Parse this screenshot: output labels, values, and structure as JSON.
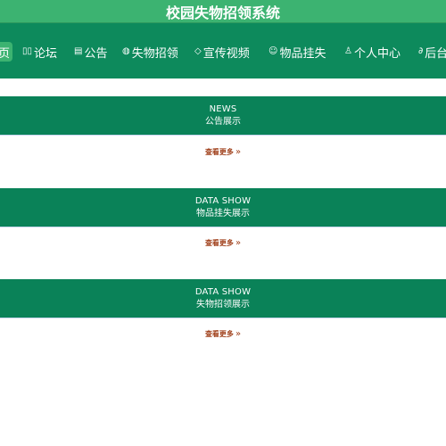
{
  "header": {
    "title": "校园失物招领系统"
  },
  "nav": {
    "items": [
      {
        "label": "页",
        "icon": "home-icon",
        "glyph": ""
      },
      {
        "label": "论坛",
        "icon": "forum-icon",
        "glyph": "▯▯"
      },
      {
        "label": "公告",
        "icon": "notice-icon",
        "glyph": "▤"
      },
      {
        "label": "失物招领",
        "icon": "globe-icon",
        "glyph": "◍"
      },
      {
        "label": "宣传视频",
        "icon": "tag-icon",
        "glyph": "◇"
      },
      {
        "label": "物品挂失",
        "icon": "smile-icon",
        "glyph": "☺"
      },
      {
        "label": "个人中心",
        "icon": "user-icon",
        "glyph": "♙"
      },
      {
        "label": "后台",
        "icon": "link-icon",
        "glyph": "∂"
      }
    ]
  },
  "sections": [
    {
      "en": "NEWS",
      "cn": "公告展示",
      "more": "查看更多"
    },
    {
      "en": "DATA SHOW",
      "cn": "物品挂失展示",
      "more": "查看更多"
    },
    {
      "en": "DATA SHOW",
      "cn": "失物招领展示",
      "more": "查看更多"
    }
  ],
  "colors": {
    "title_bar": "#3cb371",
    "nav": "#0d8a5c",
    "band": "#0a8258",
    "more_link": "#a0401b"
  }
}
